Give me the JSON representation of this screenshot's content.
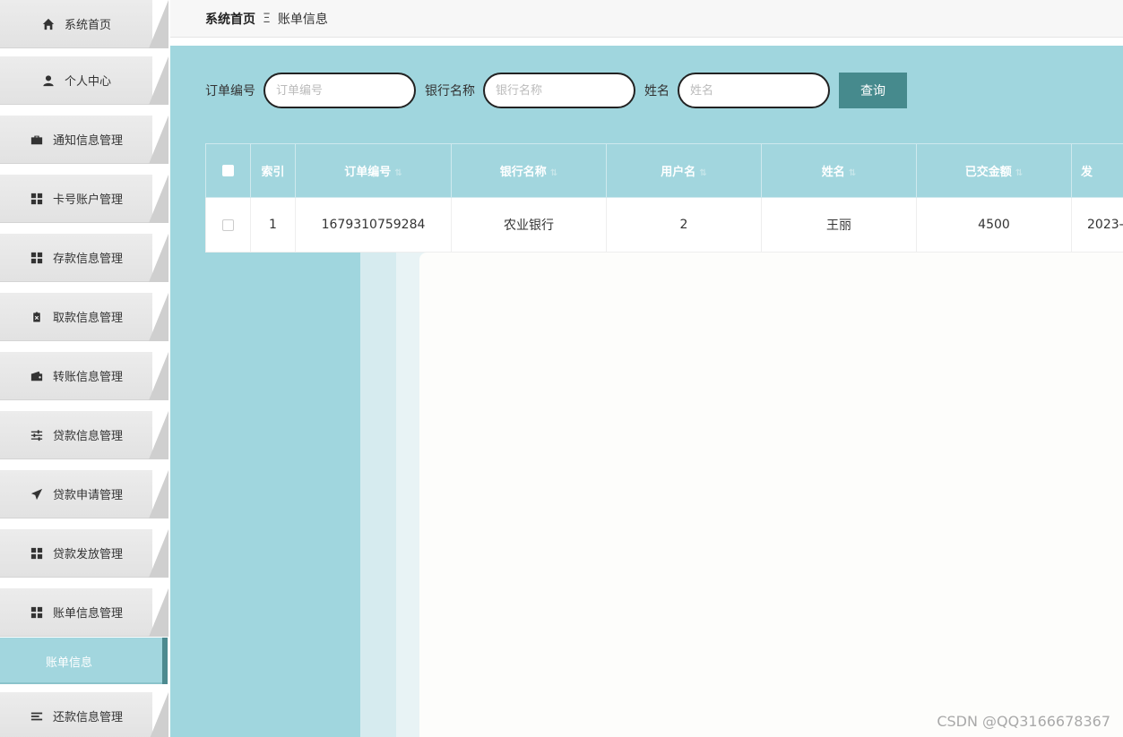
{
  "sidebar": {
    "items": [
      {
        "label": "系统首页",
        "icon": "home-icon"
      },
      {
        "label": "个人中心",
        "icon": "user-icon"
      },
      {
        "label": "通知信息管理",
        "icon": "briefcase-icon"
      },
      {
        "label": "卡号账户管理",
        "icon": "grid-icon"
      },
      {
        "label": "存款信息管理",
        "icon": "grid-icon"
      },
      {
        "label": "取款信息管理",
        "icon": "clipboard-x-icon"
      },
      {
        "label": "转账信息管理",
        "icon": "wallet-icon"
      },
      {
        "label": "贷款信息管理",
        "icon": "sliders-icon"
      },
      {
        "label": "贷款申请管理",
        "icon": "send-icon"
      },
      {
        "label": "贷款发放管理",
        "icon": "grid-icon"
      },
      {
        "label": "账单信息管理",
        "icon": "grid-icon"
      },
      {
        "label": "还款信息管理",
        "icon": "menu-lines-icon"
      }
    ],
    "active_sub": "账单信息"
  },
  "breadcrumb": {
    "home": "系统首页",
    "separator": "Ξ",
    "current": "账单信息"
  },
  "search": {
    "order_label": "订单编号",
    "order_placeholder": "订单编号",
    "bank_label": "银行名称",
    "bank_placeholder": "银行名称",
    "name_label": "姓名",
    "name_placeholder": "姓名",
    "query_button": "查询"
  },
  "table": {
    "headers": [
      "索引",
      "订单编号",
      "银行名称",
      "用户名",
      "姓名",
      "已交金额",
      "发"
    ],
    "rows": [
      {
        "index": "1",
        "order_no": "1679310759284",
        "bank": "农业银行",
        "username": "2",
        "name": "王丽",
        "paid": "4500",
        "date": "2023-"
      }
    ]
  },
  "watermark": "CSDN @QQ3166678367",
  "colors": {
    "accent": "#a0d6de",
    "button": "#468a8d",
    "active_border": "#4d8a8f"
  }
}
